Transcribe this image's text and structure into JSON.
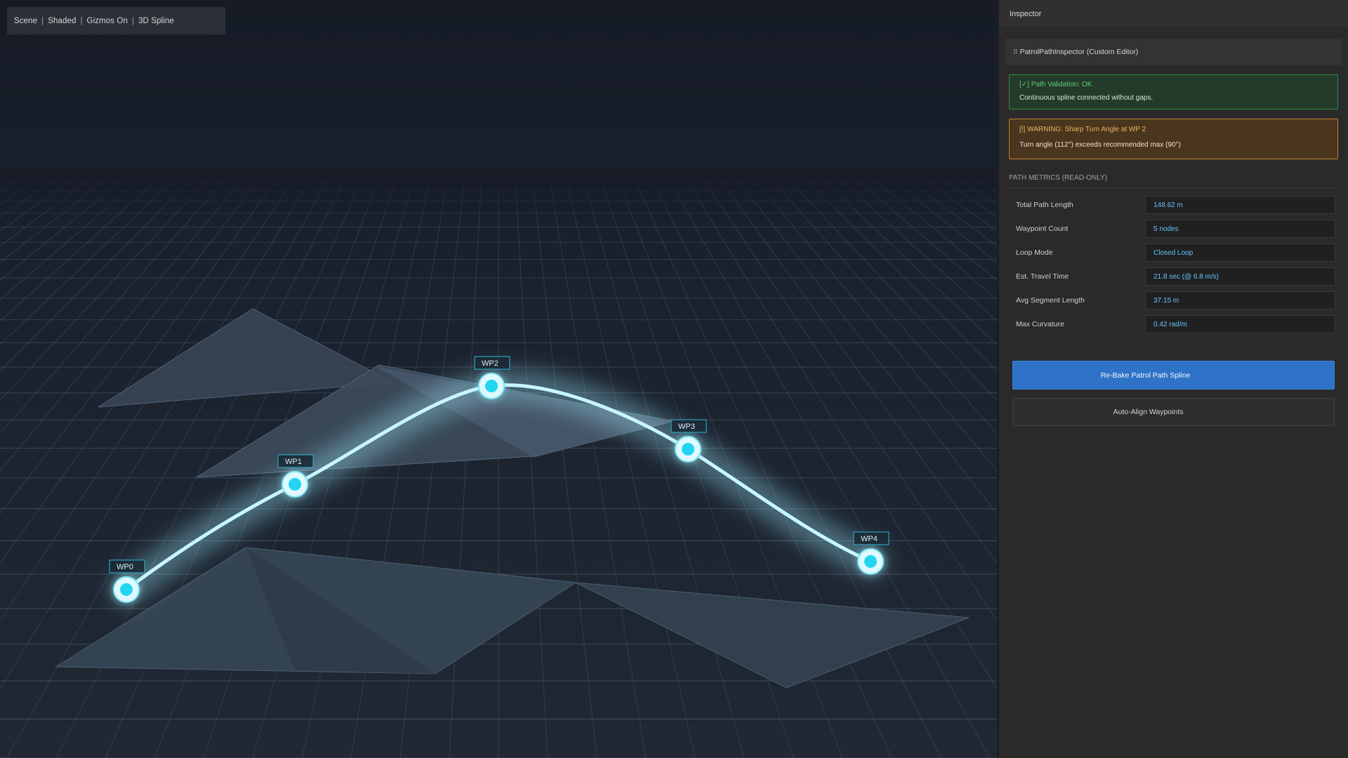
{
  "scene_toolbar": {
    "items": [
      "Scene",
      "Shaded",
      "Gizmos On",
      "3D Spline"
    ],
    "separator": "|"
  },
  "viewport": {
    "waypoints": [
      {
        "label": "WP0"
      },
      {
        "label": "WP1"
      },
      {
        "label": "WP2"
      },
      {
        "label": "WP3"
      },
      {
        "label": "WP4"
      }
    ],
    "colors": {
      "spline": "#c8f6ff",
      "glow": "#9fefff",
      "node": "#22d6f2",
      "grid": "#5b6b7b",
      "terrain": "#3c4a59"
    }
  },
  "inspector": {
    "title": "Inspector",
    "component": {
      "grip_icon": "grip-icon",
      "grip_glyph": "⠿",
      "title": "PatrolPathInspector (Custom Editor)"
    },
    "validation": {
      "icon": "check-icon",
      "icon_glyph": "[✓]",
      "title": "Path Validation: OK",
      "message": "Continuous spline connected without gaps."
    },
    "warning": {
      "icon": "warning-icon",
      "icon_glyph": "[!]",
      "title": "WARNING: Sharp Turn Angle at WP 2",
      "message": "Turn angle (112°) exceeds recommended max (90°)"
    },
    "metrics_title": "PATH METRICS (READ-ONLY)",
    "metrics": [
      {
        "label": "Total Path Length",
        "value": "148.62 m"
      },
      {
        "label": "Waypoint Count",
        "value": "5 nodes"
      },
      {
        "label": "Loop Mode",
        "value": "Closed Loop"
      },
      {
        "label": "Est. Travel Time",
        "value": "21.8 sec (@ 6.8 m/s)"
      },
      {
        "label": "Avg Segment Length",
        "value": "37.15 m"
      },
      {
        "label": "Max Curvature",
        "value": "0.42 rad/m"
      }
    ],
    "rebake_label": "Re-Bake Patrol Path Spline",
    "align_label": "Auto-Align Waypoints",
    "colors": {
      "ok": "#2f8a45",
      "warn": "#c3802a",
      "accent": "#2f73c8",
      "value": "#63c3ff"
    }
  }
}
